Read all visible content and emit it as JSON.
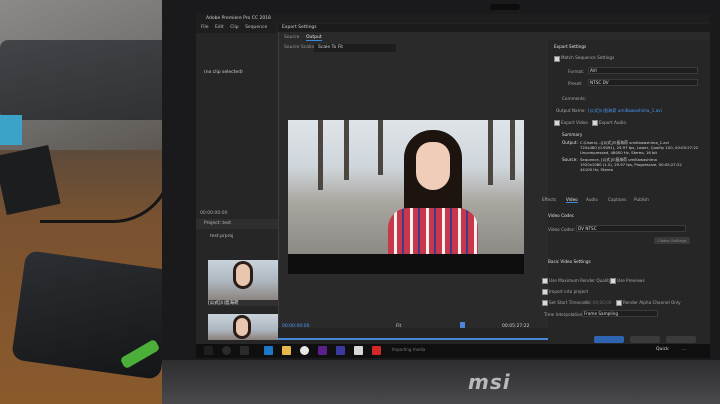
{
  "window": {
    "title": "Adobe Premiere Pro CC 2018",
    "menu": [
      "File",
      "Edit",
      "Clip",
      "Sequence",
      "Marke"
    ]
  },
  "left_panel": {
    "no_clip": "(no clip selected)",
    "timecode": "00:00:00:00",
    "project_header": "Project: test",
    "project_file": "test.prproj",
    "clip_label": "[公式]川島海荷"
  },
  "export_dialog": {
    "title": "Export Settings",
    "tabs": [
      "Source",
      "Output"
    ],
    "source_scaling_label": "Source Scaling:",
    "source_scaling_value": "Scale To Fit",
    "timecode_in": "00:00:00:00",
    "timecode_out": "00:05:27:22",
    "fit": "Fit"
  },
  "settings": {
    "section_title": "Export Settings",
    "match_sequence": "Match Sequence Settings",
    "format_label": "Format:",
    "format_value": "AVI",
    "preset_label": "Preset:",
    "preset_value": "NTSC DV",
    "comments_label": "Comments:",
    "output_name_label": "Output Name:",
    "output_name_value": "[公式]川島海荷 umiKawashima_1.avi",
    "export_video": "Export Video",
    "export_audio": "Export Audio",
    "summary": "Summary",
    "output_label": "Output:",
    "output_text": "C:\\Users\\...\\[公式]川島海荷 umiKawashima_1.avi",
    "output_text2": "720x480 (0.9091), 29.97 fps, Lower, Quality 100, 00:05:27:22",
    "output_text3": "Uncompressed, 48000 Hz, Stereo, 16 bit",
    "source_label": "Source:",
    "source_text": "Sequence, [公式]川島海荷 umiKawashima",
    "source_text2": "1920x1080 (1.0), 29.97 fps, Progressive, 00:05:27:22",
    "source_text3": "44100 Hz, Stereo",
    "tabs": [
      "Effects",
      "Video",
      "Audio",
      "Captions",
      "Publish"
    ],
    "video_codec_header": "Video Codec",
    "video_codec_label": "Video Codec:",
    "video_codec_value": "DV NTSC",
    "codec_settings_btn": "Codec Settings",
    "basic_video_header": "Basic Video Settings",
    "use_max_render": "Use Maximum Render Quality",
    "use_previews": "Use Previews",
    "import_into_project": "Import into project",
    "set_start_tc": "Set Start Timecode",
    "start_tc_value": "00;00;00;00",
    "render_alpha": "Render Alpha Channel Only",
    "time_interp_label": "Time Interpolation:",
    "time_interp_value": "Frame Sampling"
  },
  "taskbar": {
    "status": "Importing media",
    "quick": "Quick",
    "time": "..."
  },
  "hardware": {
    "brand": "msi"
  }
}
